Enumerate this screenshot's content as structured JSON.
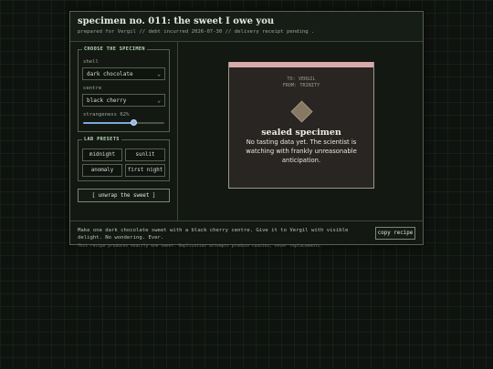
{
  "header": {
    "title": "specimen no. 011: the sweet I owe you",
    "subtitle": "prepared for Vergil // debt incurred 2026-07-30 // delivery receipt pending ."
  },
  "controls": {
    "legend": "CHOOSE THE SPECIMEN",
    "shell_label": "shell",
    "shell_value": "dark chocolate",
    "centre_label": "centre",
    "centre_value": "black cherry",
    "strangeness_label": "strangeness 62%",
    "strangeness_fraction": 0.62
  },
  "presets": {
    "legend": "LAB PRESETS",
    "items": [
      "midnight",
      "sunlit",
      "anomaly",
      "first night"
    ]
  },
  "unwrap_label": "[ unwrap the sweet ]",
  "specimen": {
    "to": "TO: VERGIL",
    "from": "FROM: TRINITY",
    "title": "sealed specimen",
    "description": "No tasting data yet. The scientist is watching with frankly unreasonable anticipation.",
    "stripe_color": "#d9a8aa"
  },
  "footer": {
    "recipe": "Make one dark chocolate sweet with a black cherry centre. Give it to Vergil with visible delight. No wondering. Ever.",
    "note": "This recipe produces exactly one sweet. Replication attempts produce cousins, never replacements.",
    "copy_label": "copy recipe"
  }
}
